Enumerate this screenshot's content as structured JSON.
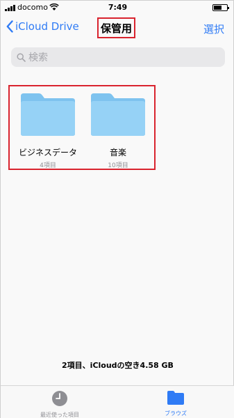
{
  "status_bar": {
    "carrier": "docomo",
    "time": "7:49",
    "battery_level": 0.6
  },
  "nav": {
    "back_label": "iCloud Drive",
    "title": "保管用",
    "select_label": "選択"
  },
  "search": {
    "placeholder": "検索"
  },
  "folders": [
    {
      "name": "ビジネスデータ",
      "count": "4項目"
    },
    {
      "name": "音楽",
      "count": "10項目"
    }
  ],
  "storage_info": "2項目、iCloudの空き4.58 GB",
  "tabs": {
    "recent_label": "最近使った項目",
    "browse_label": "ブラウズ"
  },
  "colors": {
    "accent": "#2f7bf5",
    "highlight": "#d9232e",
    "folder": "#8fcdf3"
  }
}
